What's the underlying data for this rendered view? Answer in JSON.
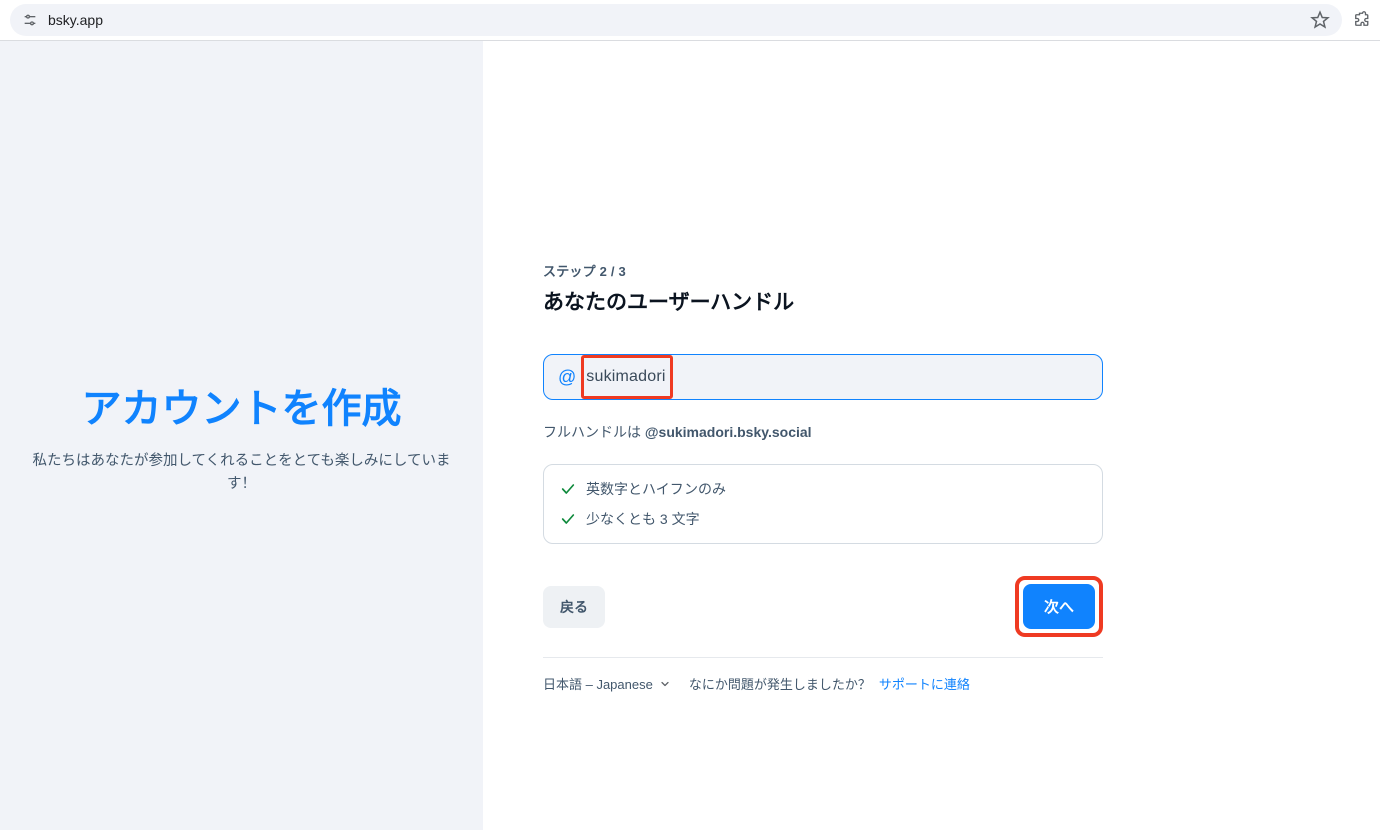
{
  "browser": {
    "url": "bsky.app"
  },
  "left": {
    "title": "アカウントを作成",
    "subtitle": "私たちはあなたが参加してくれることをとても楽しみにしています！"
  },
  "form": {
    "step_label": "ステップ 2 / 3",
    "heading": "あなたのユーザーハンドル",
    "at_symbol": "@",
    "handle_value": "sukimadori",
    "full_handle_prefix": "フルハンドルは ",
    "full_handle": "@sukimadori.bsky.social",
    "rules": [
      "英数字とハイフンのみ",
      "少なくとも 3 文字"
    ],
    "back_label": "戻る",
    "next_label": "次へ"
  },
  "footer": {
    "language": "日本語 – Japanese",
    "support_question": "なにか問題が発生しましたか？",
    "support_link": "サポートに連絡"
  },
  "colors": {
    "accent": "#1083fe",
    "highlight": "#ef3a22",
    "panel": "#f1f3f8"
  },
  "icons": {
    "site": "tune-icon",
    "star": "star-icon",
    "extension": "puzzle-icon",
    "check": "check-icon",
    "chevron": "chevron-down-icon"
  }
}
